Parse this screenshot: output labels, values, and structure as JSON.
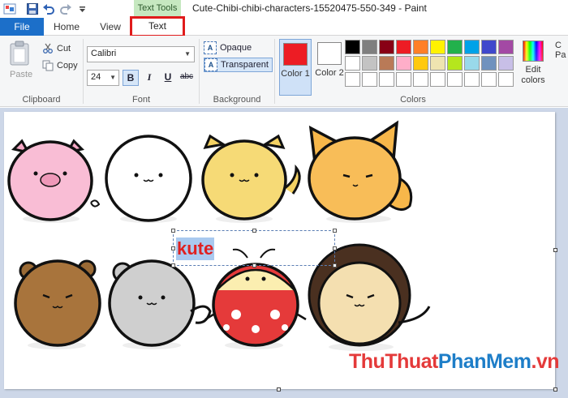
{
  "window": {
    "title": "Cute-Chibi-chibi-characters-15520475-550-349 - Paint",
    "context_tab": "Text Tools"
  },
  "quick_access": [
    "paint-app-icon",
    "save-icon",
    "undo-icon",
    "redo-icon",
    "customize-dropdown-icon"
  ],
  "tabs": {
    "file": "File",
    "home": "Home",
    "view": "View",
    "text": "Text"
  },
  "clipboard": {
    "paste": "Paste",
    "cut": "Cut",
    "copy": "Copy",
    "label": "Clipboard"
  },
  "font": {
    "family": "Calibri",
    "size": "24",
    "bold": "B",
    "italic": "I",
    "underline": "U",
    "strike": "abc",
    "label": "Font"
  },
  "background": {
    "opaque": "Opaque",
    "transparent": "Transparent",
    "selected": "Transparent",
    "label": "Background"
  },
  "colors": {
    "color1_label": "Color 1",
    "color2_label": "Color 2",
    "color1_value": "#ed1c24",
    "color2_value": "#ffffff",
    "edit_label": "Edit colors",
    "label": "Colors",
    "palette": [
      "#000000",
      "#7f7f7f",
      "#880015",
      "#ed1c24",
      "#ff7f27",
      "#fff200",
      "#22b14c",
      "#00a2e8",
      "#3f48cc",
      "#a349a4",
      "#ffffff",
      "#c3c3c3",
      "#b97a57",
      "#ffaec9",
      "#ffc90e",
      "#efe4b0",
      "#b5e61d",
      "#99d9ea",
      "#7092be",
      "#c8bfe7",
      "#ffffff",
      "#ffffff",
      "#ffffff",
      "#ffffff",
      "#ffffff",
      "#ffffff",
      "#ffffff",
      "#ffffff",
      "#ffffff",
      "#ffffff"
    ]
  },
  "ribbon_cut_label": "C Pa",
  "canvas": {
    "text_box": "kute",
    "text_color": "#e02020"
  },
  "watermark": {
    "part1": "ThuThuat",
    "part2": "PhanMem",
    "part3": ".vn"
  }
}
